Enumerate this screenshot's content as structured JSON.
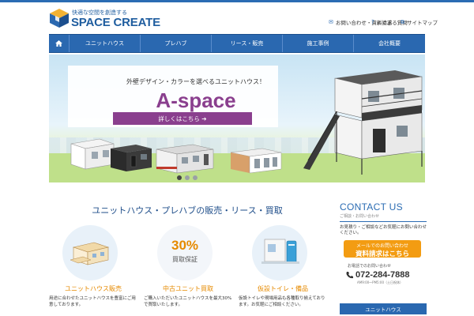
{
  "header": {
    "logo_tagline": "快適な空間を創造する",
    "logo_name": "SPACE CREATE",
    "util_links": [
      {
        "icon": "mail-icon",
        "label": "お問い合わせ・資料請求"
      },
      {
        "icon": "question-icon",
        "label": "よくある質問"
      },
      {
        "icon": "sitemap-icon",
        "label": "サイトマップ"
      }
    ]
  },
  "nav": {
    "home_icon": "home-icon",
    "items": [
      "ユニットハウス",
      "プレハブ",
      "リース・販売",
      "施工事例",
      "会社概要"
    ]
  },
  "hero": {
    "tagline": "外壁デザイン・カラーを選べるユニットハウス！",
    "brand": "A-space",
    "cta": "詳しくはこちら ➔",
    "slide_count": 3,
    "active_slide": 0
  },
  "main": {
    "headline": "ユニットハウス・プレハブの販売・リース・買取"
  },
  "features": [
    {
      "title": "ユニットハウス販売",
      "icon": "unit-house-illustration",
      "desc": "用途に合わせたユニットハウスを豊富にご用意しております。"
    },
    {
      "title": "中古ユニット買取",
      "icon": "buyback-badge",
      "badge_number": "30%",
      "badge_text": "買取保証",
      "desc": "ご購入いただいたユニットハウスを最大30%で買取いたします。"
    },
    {
      "title": "仮設トイレ・備品",
      "icon": "portable-toilet-illustration",
      "desc": "仮設トイレや現場用品も各種取り揃えております。お気軽にご相談ください。"
    }
  ],
  "contact": {
    "title": "CONTACT US",
    "subtitle": "ご相談・お問い合わせ",
    "desc": "お見積り・ご相談などお気軽にお問い合わせください。",
    "mail_line1": "メールでのお問い合わせ",
    "mail_line2": "資料請求はこちら",
    "phone_label": "お電話でのお問い合わせ",
    "phone": "072-284-7888",
    "hours": "AM9:00〜PM5:00（土日祝休）"
  },
  "sidebar": {
    "head": "ユニットハウス"
  },
  "colors": {
    "brand_blue": "#2a68b0",
    "accent_purple": "#8a3f8e",
    "accent_orange": "#f39c12"
  }
}
